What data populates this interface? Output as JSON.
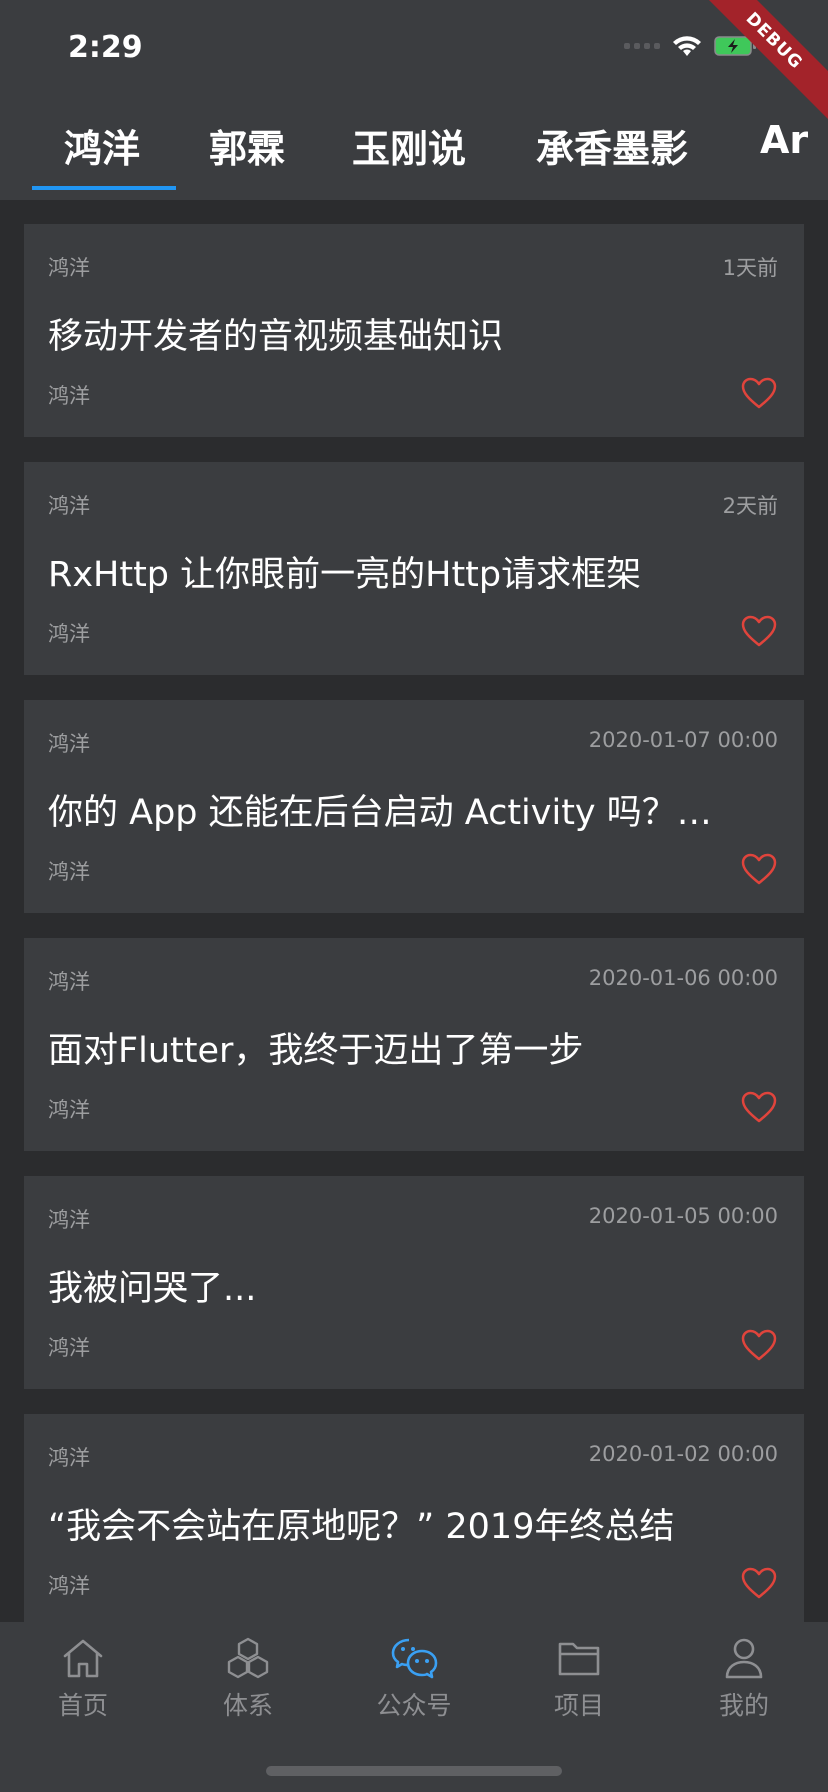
{
  "status_bar": {
    "time": "2:29",
    "debug_label": "DEBUG"
  },
  "tabs": [
    {
      "label": "鸿洋",
      "active": true
    },
    {
      "label": "郭霖",
      "active": false
    },
    {
      "label": "玉刚说",
      "active": false
    },
    {
      "label": "承香墨影",
      "active": false
    },
    {
      "label": "Ar",
      "active": false
    }
  ],
  "articles": [
    {
      "author": "鸿洋",
      "date": "1天前",
      "title": "移动开发者的音视频基础知识",
      "chapter": "鸿洋"
    },
    {
      "author": "鸿洋",
      "date": "2天前",
      "title": "RxHttp 让你眼前一亮的Http请求框架",
      "chapter": "鸿洋"
    },
    {
      "author": "鸿洋",
      "date": "2020-01-07 00:00",
      "title": "你的 App 还能在后台启动 Activity 吗？…",
      "chapter": "鸿洋"
    },
    {
      "author": "鸿洋",
      "date": "2020-01-06 00:00",
      "title": "面对Flutter，我终于迈出了第一步",
      "chapter": "鸿洋"
    },
    {
      "author": "鸿洋",
      "date": "2020-01-05 00:00",
      "title": "我被问哭了...",
      "chapter": "鸿洋"
    },
    {
      "author": "鸿洋",
      "date": "2020-01-02 00:00",
      "title": "“我会不会站在原地呢？” 2019年终总结",
      "chapter": "鸿洋"
    }
  ],
  "bottom_nav": [
    {
      "label": "首页",
      "icon": "home-icon",
      "active": false
    },
    {
      "label": "体系",
      "icon": "cubes-icon",
      "active": false
    },
    {
      "label": "公众号",
      "icon": "wechat-icon",
      "active": true
    },
    {
      "label": "项目",
      "icon": "folder-icon",
      "active": false
    },
    {
      "label": "我的",
      "icon": "user-icon",
      "active": false
    }
  ],
  "colors": {
    "background": "#2b2c2e",
    "card": "#3b3d40",
    "accent": "#2196f3",
    "nav_active": "#3aa0f3",
    "heart": "#e0443c",
    "secondary_text": "#9d9ea0"
  }
}
